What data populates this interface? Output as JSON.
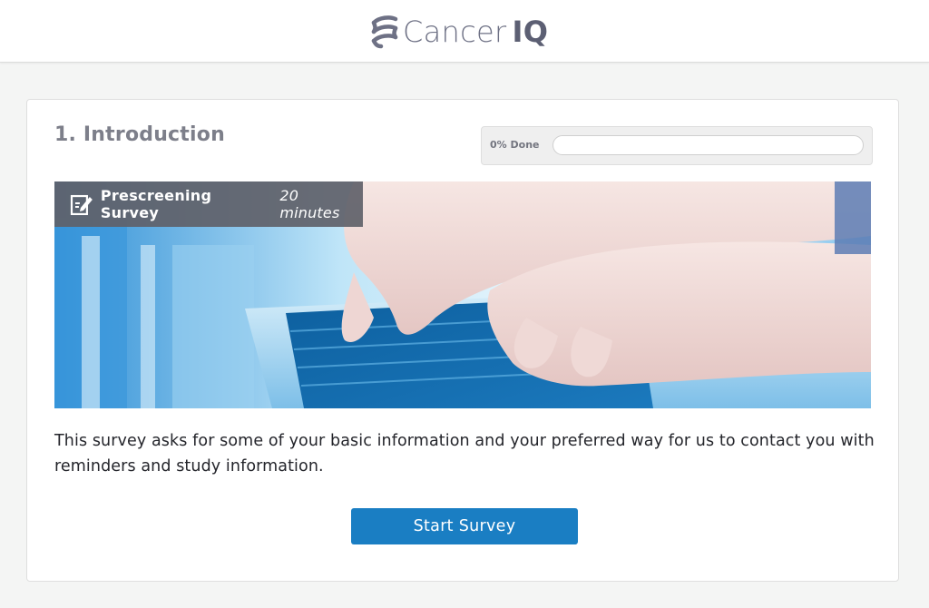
{
  "header": {
    "logo": {
      "brand_light": "Cancer",
      "brand_bold": "IQ",
      "icon": "cancer-iq-logo-icon"
    }
  },
  "section": {
    "title": "1. Introduction"
  },
  "progress": {
    "label": "0% Done",
    "value": 0
  },
  "hero": {
    "icon": "edit-document-icon",
    "survey_name": "Prescreening Survey",
    "survey_duration": "20 minutes"
  },
  "description": "This survey asks for some of your basic information and your preferred way for us to contact you with reminders and study information.",
  "actions": {
    "start_label": "Start Survey"
  },
  "colors": {
    "accent": "#1a7ec3",
    "brand_text": "#6e7185",
    "banner": "#5f6169"
  }
}
